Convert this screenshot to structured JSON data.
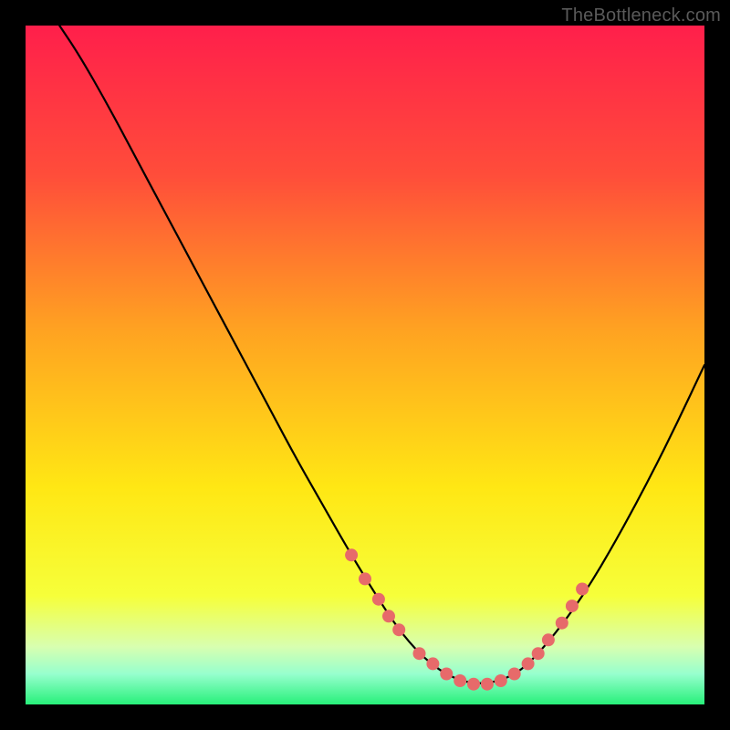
{
  "watermark": "TheBottleneck.com",
  "chart_data": {
    "type": "line",
    "title": "",
    "xlabel": "",
    "ylabel": "",
    "xlim": [
      0,
      100
    ],
    "ylim": [
      0,
      100
    ],
    "gradient_stops": [
      {
        "offset": 0.0,
        "color": "#ff1f4b"
      },
      {
        "offset": 0.22,
        "color": "#ff4d3a"
      },
      {
        "offset": 0.45,
        "color": "#ffa321"
      },
      {
        "offset": 0.68,
        "color": "#ffe714"
      },
      {
        "offset": 0.84,
        "color": "#f6ff3a"
      },
      {
        "offset": 0.915,
        "color": "#d8ffb0"
      },
      {
        "offset": 0.955,
        "color": "#97ffce"
      },
      {
        "offset": 1.0,
        "color": "#27f07a"
      }
    ],
    "series": [
      {
        "name": "bottleneck-curve",
        "x": [
          5.0,
          8.0,
          12.0,
          16.0,
          20.0,
          24.0,
          28.0,
          32.0,
          36.0,
          40.0,
          44.0,
          48.0,
          52.0,
          55.0,
          58.0,
          61.0,
          64.0,
          67.0,
          70.0,
          73.0,
          76.0,
          80.0,
          84.0,
          88.0,
          92.0,
          96.0,
          100.0
        ],
        "y": [
          100.0,
          95.5,
          88.5,
          81.0,
          73.5,
          66.0,
          58.5,
          51.0,
          43.5,
          36.0,
          29.0,
          22.0,
          15.5,
          11.0,
          7.5,
          5.0,
          3.5,
          3.0,
          3.5,
          5.0,
          8.0,
          13.0,
          19.0,
          26.0,
          33.5,
          41.5,
          50.0
        ]
      }
    ],
    "markers": {
      "name": "highlight-points",
      "color": "#e76a6a",
      "radius": 7,
      "points": [
        {
          "x": 48.0,
          "y": 22.0
        },
        {
          "x": 50.0,
          "y": 18.5
        },
        {
          "x": 52.0,
          "y": 15.5
        },
        {
          "x": 53.5,
          "y": 13.0
        },
        {
          "x": 55.0,
          "y": 11.0
        },
        {
          "x": 58.0,
          "y": 7.5
        },
        {
          "x": 60.0,
          "y": 6.0
        },
        {
          "x": 62.0,
          "y": 4.5
        },
        {
          "x": 64.0,
          "y": 3.5
        },
        {
          "x": 66.0,
          "y": 3.0
        },
        {
          "x": 68.0,
          "y": 3.0
        },
        {
          "x": 70.0,
          "y": 3.5
        },
        {
          "x": 72.0,
          "y": 4.5
        },
        {
          "x": 74.0,
          "y": 6.0
        },
        {
          "x": 75.5,
          "y": 7.5
        },
        {
          "x": 77.0,
          "y": 9.5
        },
        {
          "x": 79.0,
          "y": 12.0
        },
        {
          "x": 80.5,
          "y": 14.5
        },
        {
          "x": 82.0,
          "y": 17.0
        }
      ]
    }
  }
}
